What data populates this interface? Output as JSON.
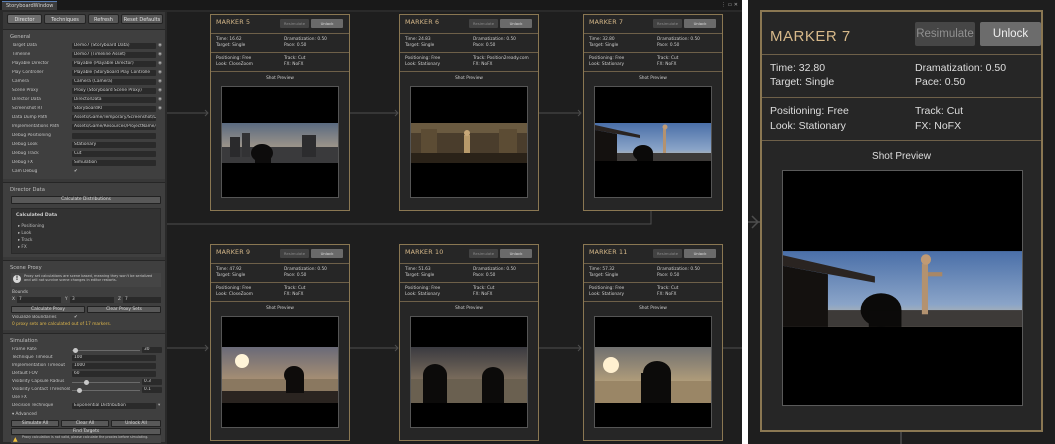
{
  "window": {
    "tab": "StoryboardWindow",
    "controls": "⋮ ▭ ✕"
  },
  "toolbar": [
    "Director",
    "Techniques",
    "Refresh",
    "Reset Defaults"
  ],
  "general": {
    "header": "General",
    "rows": [
      {
        "label": "Target Data",
        "value": "Demo7 (Storyboard Data)",
        "dot": true
      },
      {
        "label": "Timeline",
        "value": "Demo7 (Timeline Asset)",
        "dot": true
      },
      {
        "label": "Playable Director",
        "value": "Playable (Playable Director)",
        "dot": true
      },
      {
        "label": "Play Controller",
        "value": "Playable (Storyboard Play Controlle",
        "dot": true
      },
      {
        "label": "Camera",
        "value": "Camera (Camera)",
        "dot": true
      },
      {
        "label": "Scene Proxy",
        "value": "Proxy (Storyboard Scene Proxy)",
        "dot": true
      },
      {
        "label": "Director Data",
        "value": "DirectorData",
        "dot": true
      },
      {
        "label": "Screenshot RT",
        "value": "StoryboardRT",
        "dot": true
      },
      {
        "label": "Data Dump Path",
        "value": "Assets/Game/Temporary/Screenshot/Dum",
        "dot": false
      },
      {
        "label": "Implementations Path",
        "value": "Assets/Game/Resources/ProjectName/T",
        "dot": false
      },
      {
        "label": "Debug Positioning",
        "value": "",
        "dot": false
      },
      {
        "label": "Debug Look",
        "value": "Stationary",
        "dot": false
      },
      {
        "label": "Debug Track",
        "value": "Cut",
        "dot": false
      },
      {
        "label": "Debug FX",
        "value": "Simulation",
        "dot": false
      },
      {
        "label": "Cam Debug",
        "value": "✔",
        "dot": false,
        "plain": true
      }
    ]
  },
  "director": {
    "header": "Director Data",
    "button": "Calculate Distributions",
    "calc_title": "Calculated Data",
    "items": [
      "▸ Positioning",
      "▸ Look",
      "▸ Track",
      "▸ FX"
    ]
  },
  "proxy": {
    "header": "Scene Proxy",
    "info": "Proxy set calculations are scene based, meaning they won't be serialized and will not survive scene changes in editor restarts.",
    "bounds_label": "Bounds",
    "bounds": {
      "x": "7",
      "y": "3",
      "z": "7"
    },
    "calc_button": "Calculate Proxy",
    "clear_button": "Clear Proxy Sets",
    "visualize_label": "Visualize Boundaries",
    "visualize_value": "✔",
    "status": "0 proxy sets are calculated out of 17 markers."
  },
  "simulation": {
    "header": "Simulation",
    "rows": [
      {
        "label": "Frame Rate",
        "value": "30",
        "slider": 0.05
      },
      {
        "label": "Technique Timeout",
        "value": "100"
      },
      {
        "label": "Implementation Timeout",
        "value": "1000"
      },
      {
        "label": "Default FOV",
        "value": "60"
      },
      {
        "label": "Visibility Capsule Radius",
        "value": "0.3",
        "slider": 0.2
      },
      {
        "label": "Visibility Contact Threshold",
        "value": "0.1",
        "slider": 0.1
      },
      {
        "label": "Use FX",
        "value": "",
        "plain": true
      },
      {
        "label": "Decision Technique",
        "value": "Exponential Distribution"
      }
    ],
    "advanced": "▾ Advanced",
    "btn_sim": "Simulate All",
    "btn_clear": "Clear All",
    "btn_unlock": "Unlock All",
    "btn_find": "Find Targets",
    "warning": "Proxy calculation is not valid, please calculate the proxies before simulating."
  },
  "markers": [
    {
      "title": "MARKER 5",
      "time": "Time: 16.62",
      "target": "Target: Single",
      "dram": "Dramatization: 0.50",
      "pace": "Pace: 0.50",
      "pos": "Positioning: Free",
      "look": "Look: CloseZoom",
      "track": "Track: Cut",
      "fx": "FX: NoFX"
    },
    {
      "title": "MARKER 6",
      "time": "Time: 24.83",
      "target": "Target: Single",
      "dram": "Dramatization: 0.50",
      "pace": "Pace: 0.50",
      "pos": "Positioning: Free",
      "look": "Look: Stationary",
      "track": "Track: Position2ready.com",
      "fx": "FX: NoFX"
    },
    {
      "title": "MARKER 7",
      "time": "Time: 32.80",
      "target": "Target: Single",
      "dram": "Dramatization: 0.50",
      "pace": "Pace: 0.50",
      "pos": "Positioning: Free",
      "look": "Look: Stationary",
      "track": "Track: Cut",
      "fx": "FX: NoFX"
    },
    {
      "title": "MARKER 9",
      "time": "Time: 47.92",
      "target": "Target: Single",
      "dram": "Dramatization: 0.50",
      "pace": "Pace: 0.50",
      "pos": "Positioning: Free",
      "look": "Look: CloseZoom",
      "track": "Track: Cut",
      "fx": "FX: NoFX"
    },
    {
      "title": "MARKER 10",
      "time": "Time: 51.63",
      "target": "Target: Single",
      "dram": "Dramatization: 0.50",
      "pace": "Pace: 0.50",
      "pos": "Positioning: Free",
      "look": "Look: Stationary",
      "track": "Track: Cut",
      "fx": "FX: NoFX"
    },
    {
      "title": "MARKER 11",
      "time": "Time: 57.32",
      "target": "Target: Single",
      "dram": "Dramatization: 0.50",
      "pace": "Pace: 0.50",
      "pos": "Positioning: Free",
      "look": "Look: Stationary",
      "track": "Track: Cut",
      "fx": "FX: NoFX"
    }
  ],
  "card_buttons": {
    "resimulate": "Resimulate",
    "unlock": "Unlock"
  },
  "shot_preview": "Shot Preview",
  "zoom": {
    "title": "MARKER 7",
    "resimulate": "Resimulate",
    "unlock": "Unlock",
    "time": "Time: 32.80",
    "target": "Target: Single",
    "dram": "Dramatization: 0.50",
    "pace": "Pace: 0.50",
    "pos": "Positioning: Free",
    "look": "Look: Stationary",
    "track": "Track: Cut",
    "fx": "FX: NoFX",
    "preview": "Shot Preview"
  },
  "colors": {
    "accent": "#d7b98a",
    "card_border": "#8a7752",
    "editor_bg": "#2a2a2a",
    "panel_bg": "#383838"
  }
}
